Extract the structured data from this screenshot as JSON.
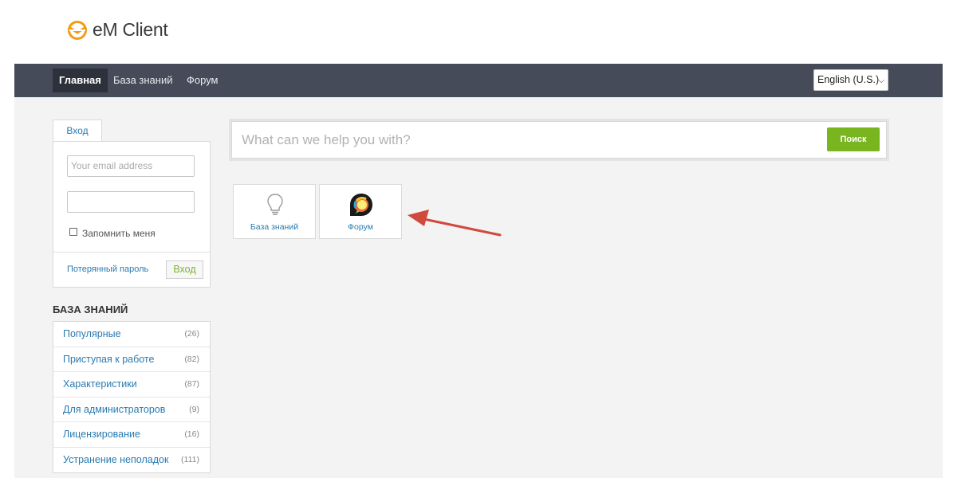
{
  "brand": {
    "name": "eM Client",
    "color": "#f39c12"
  },
  "nav": {
    "items": [
      {
        "label": "Главная",
        "active": true
      },
      {
        "label": "База знаний",
        "active": false
      },
      {
        "label": "Форум",
        "active": false
      }
    ],
    "language": "English (U.S.)"
  },
  "login": {
    "tab_label": "Вход",
    "email_placeholder": "Your email address",
    "password_value": "",
    "remember_label": "Запомнить меня",
    "remember_checked": false,
    "lost_password": "Потерянный пароль",
    "submit_label": "Вход"
  },
  "knowledge_base": {
    "title": "БАЗА ЗНАНИЙ",
    "items": [
      {
        "label": "Популярные",
        "count": "(26)"
      },
      {
        "label": "Приступая к работе",
        "count": "(82)"
      },
      {
        "label": "Характеристики",
        "count": "(87)"
      },
      {
        "label": "Для администраторов",
        "count": "(9)"
      },
      {
        "label": "Лицензирование",
        "count": "(16)"
      },
      {
        "label": "Устранение неполадок",
        "count": "(111)"
      }
    ]
  },
  "search": {
    "placeholder": "What can we help you with?",
    "button_label": "Поиск"
  },
  "tiles": [
    {
      "label": "База знаний",
      "icon": "lightbulb-icon"
    },
    {
      "label": "Форум",
      "icon": "forum-chat-icon"
    }
  ],
  "colors": {
    "navbar": "#454b58",
    "accent_green": "#78b51e",
    "link_blue": "#2a7ab0",
    "annotation_arrow": "#d0493c"
  }
}
